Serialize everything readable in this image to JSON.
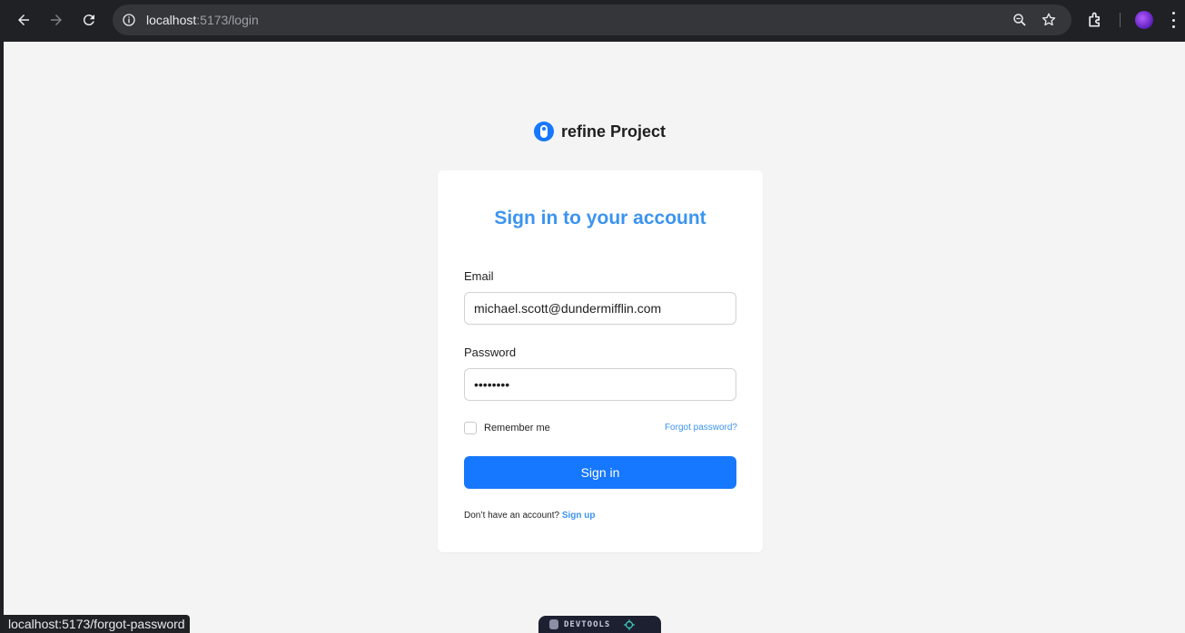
{
  "browser": {
    "url_host": "localhost",
    "url_rest": ":5173/login",
    "status_url": "localhost:5173/forgot-password"
  },
  "brand": {
    "name": "refine Project",
    "color": "#1677ff"
  },
  "login": {
    "title": "Sign in to your account",
    "email_label": "Email",
    "email_value": "michael.scott@dundermifflin.com",
    "password_label": "Password",
    "password_value": "••••••••",
    "remember_label": "Remember me",
    "forgot_label": "Forgot password?",
    "signin_label": "Sign in",
    "signup_prompt": "Don’t have an account?",
    "signup_link": "Sign up"
  },
  "devtools": {
    "label": "DEVTOOLS"
  }
}
